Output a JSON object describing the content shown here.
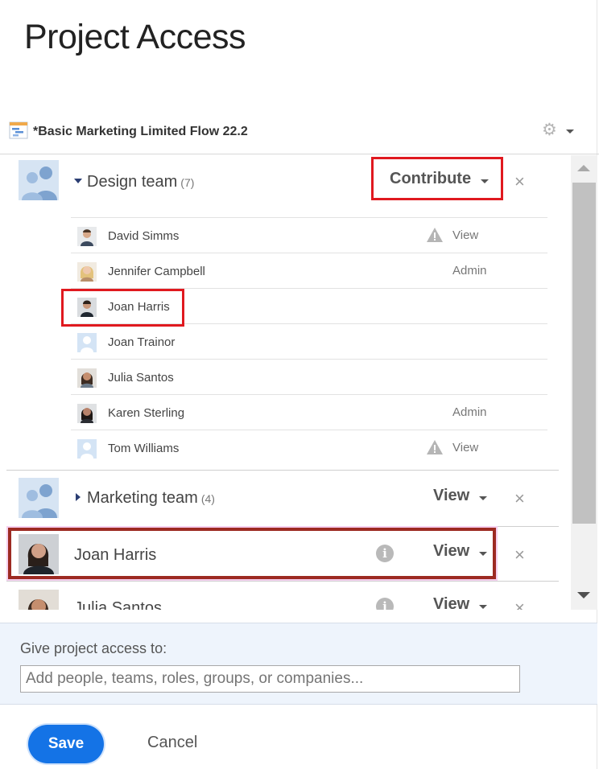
{
  "page": {
    "title": "Project Access"
  },
  "project": {
    "name": "*Basic Marketing Limited Flow 22.2",
    "icon": "project-gantt-icon",
    "settings_icon": "gear-icon"
  },
  "groups": [
    {
      "name": "Design team",
      "count": "(7)",
      "expanded": true,
      "permission": "Contribute",
      "members": [
        {
          "name": "David Simms",
          "access": "View",
          "warning": true
        },
        {
          "name": "Jennifer Campbell",
          "access": "Admin",
          "warning": false
        },
        {
          "name": "Joan Harris",
          "access": "",
          "warning": false
        },
        {
          "name": "Joan Trainor",
          "access": "",
          "warning": false
        },
        {
          "name": "Julia Santos",
          "access": "",
          "warning": false
        },
        {
          "name": "Karen Sterling",
          "access": "Admin",
          "warning": false
        },
        {
          "name": "Tom Williams",
          "access": "View",
          "warning": true
        }
      ]
    },
    {
      "name": "Marketing team",
      "count": "(4)",
      "expanded": false,
      "permission": "View"
    }
  ],
  "people": [
    {
      "name": "Joan Harris",
      "permission": "View",
      "info_icon": "i"
    },
    {
      "name": "Julia Santos",
      "permission": "View",
      "info_icon": "i"
    }
  ],
  "give_access": {
    "label": "Give project access to:",
    "placeholder": "Add people, teams, roles, groups, or companies..."
  },
  "actions": {
    "save": "Save",
    "cancel": "Cancel"
  },
  "colors": {
    "highlight_red": "#e0191f",
    "highlight_dark_red": "#9d2a22",
    "save_button": "#1473e6",
    "give_panel_bg": "#eef4fc"
  }
}
